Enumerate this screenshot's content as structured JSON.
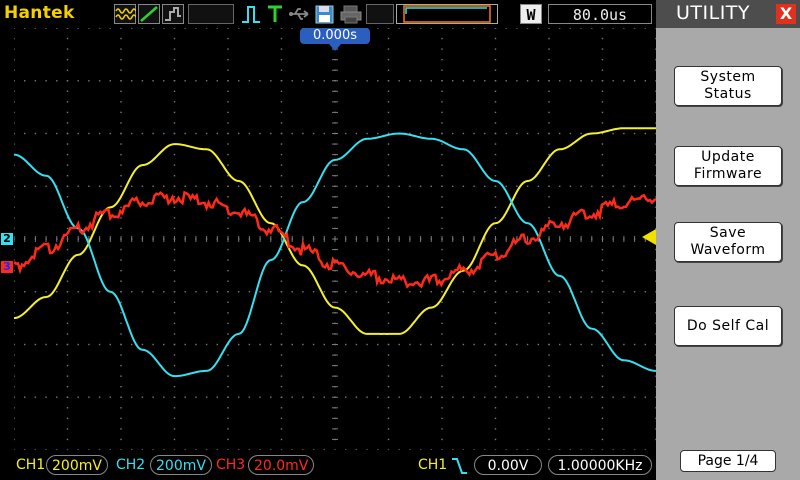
{
  "topbar": {
    "brand": "Hantek",
    "timebase": "80.0us",
    "window_label": "W",
    "trigger_position": "0.000s"
  },
  "icons": {
    "acquire_modes": [
      "sample-mode-icon",
      "peak-detect-icon",
      "average-mode-icon"
    ],
    "trigger_edge": "rising-edge-icon",
    "trigger_status": "trigger-T-icon",
    "usb": "usb-icon",
    "save": "floppy-disk-icon",
    "print": "printer-icon"
  },
  "markers": {
    "ch2": "2",
    "ch3": "3"
  },
  "bottombar": {
    "ch1_label": "CH1",
    "ch1_scale": "200mV",
    "ch2_label": "CH2",
    "ch2_scale": "200mV",
    "ch3_label": "CH3",
    "ch3_scale": "20.0mV",
    "trigger_source": "CH1",
    "trigger_level": "0.00V",
    "frequency": "1.00000KHz"
  },
  "panel": {
    "title": "UTILITY",
    "close_label": "X",
    "buttons": [
      {
        "label": "System\nStatus"
      },
      {
        "label": "Update\nFirmware"
      },
      {
        "label": "Save\nWaveform"
      },
      {
        "label": "Do Self Cal"
      }
    ],
    "page": "Page 1/4"
  },
  "colors": {
    "ch1": "#f5f02a",
    "ch2": "#35e0f0",
    "ch3": "#ff2a1a",
    "grid": "#7a7a7a",
    "brand": "#f5d000",
    "trigger_marker": "#f0e000"
  },
  "chart_data": {
    "type": "line",
    "title": "",
    "xlabel": "",
    "ylabel": "",
    "xlim": [
      0,
      10
    ],
    "ylim": [
      -4,
      4
    ],
    "grid": true,
    "series": [
      {
        "channel": "CH1",
        "x": [
          0,
          0.5,
          1,
          1.5,
          2,
          2.5,
          3,
          3.5,
          4,
          4.5,
          5,
          5.5,
          6,
          6.5,
          7,
          7.5,
          8,
          8.5,
          9,
          9.5,
          10
        ],
        "y": [
          -1.5,
          -1.1,
          -0.3,
          0.6,
          1.4,
          1.8,
          1.7,
          1.1,
          0.3,
          -0.5,
          -1.3,
          -1.8,
          -1.8,
          -1.3,
          -0.6,
          0.3,
          1.1,
          1.7,
          2.0,
          2.1,
          2.1
        ]
      },
      {
        "channel": "CH2",
        "x": [
          0,
          0.5,
          1,
          1.5,
          2,
          2.5,
          3,
          3.5,
          4,
          4.5,
          5,
          5.5,
          6,
          6.5,
          7,
          7.5,
          8,
          8.5,
          9,
          9.5,
          10
        ],
        "y": [
          1.6,
          1.2,
          0.2,
          -1.0,
          -2.1,
          -2.6,
          -2.5,
          -1.8,
          -0.4,
          0.7,
          1.5,
          1.9,
          2.0,
          1.9,
          1.7,
          1.1,
          0.3,
          -0.7,
          -1.7,
          -2.3,
          -2.5
        ]
      },
      {
        "channel": "CH3",
        "x": [
          0,
          0.5,
          1,
          1.5,
          2,
          2.5,
          3,
          3.5,
          4,
          4.5,
          5,
          5.5,
          6,
          6.5,
          7,
          7.5,
          8,
          8.5,
          9,
          9.5,
          10
        ],
        "y": [
          -0.5,
          -0.2,
          0.2,
          0.5,
          0.7,
          0.8,
          0.7,
          0.5,
          0.2,
          -0.2,
          -0.5,
          -0.7,
          -0.8,
          -0.8,
          -0.6,
          -0.3,
          0.0,
          0.3,
          0.5,
          0.7,
          0.8
        ]
      }
    ]
  }
}
